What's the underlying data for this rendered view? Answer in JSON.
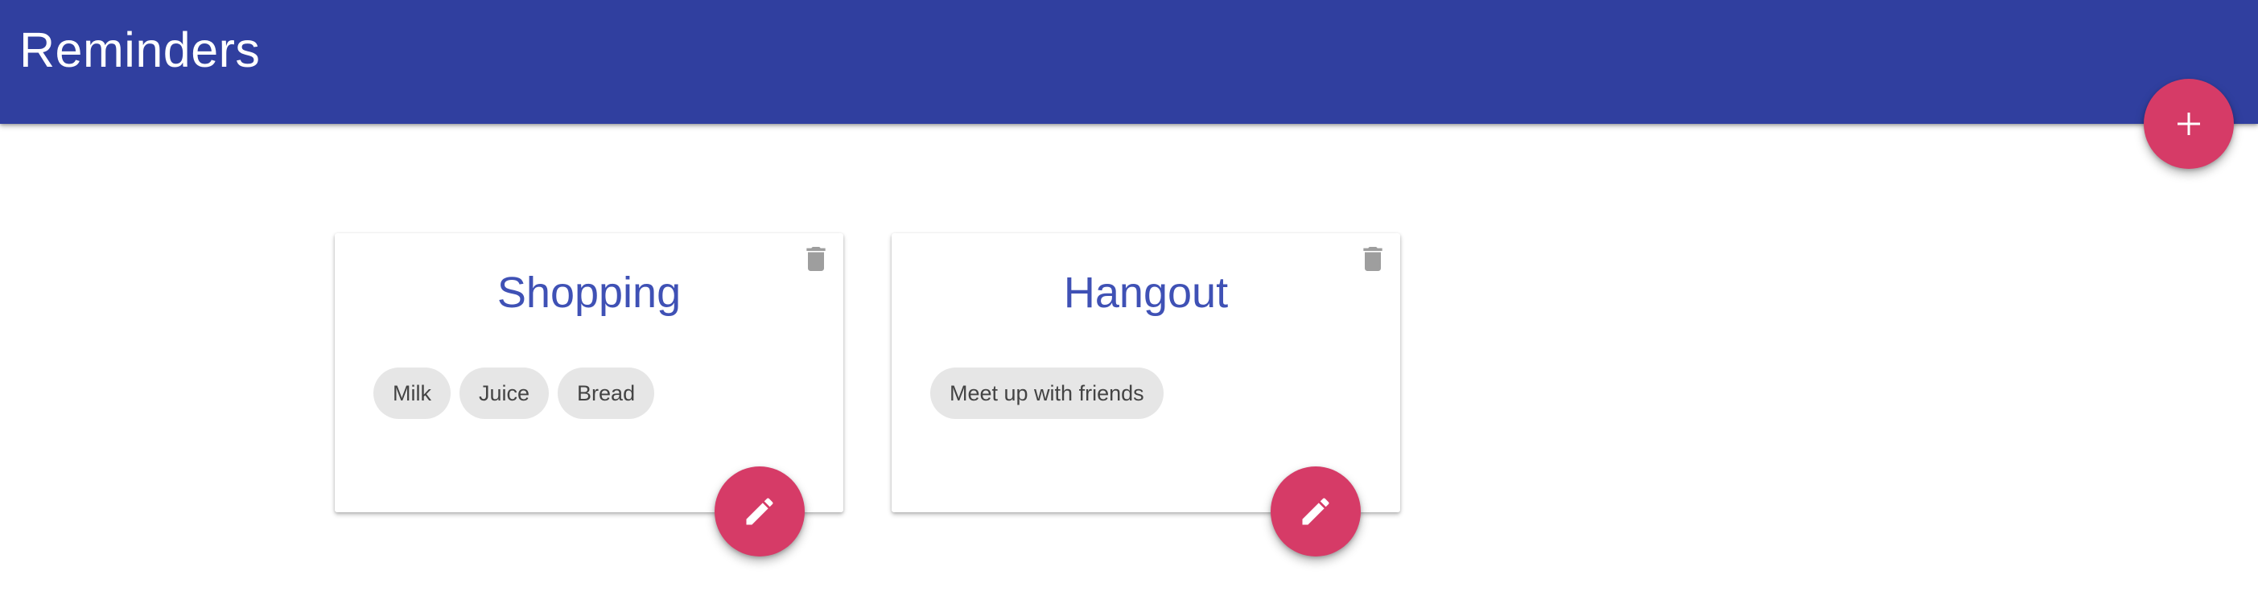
{
  "app": {
    "title": "Reminders",
    "colors": {
      "appbar": "#303f9f",
      "accent": "#d63b67",
      "card_title": "#3f51b5",
      "chip_bg": "#e6e6e6"
    }
  },
  "actions": {
    "add_icon": "plus-icon"
  },
  "cards": [
    {
      "title": "Shopping",
      "delete_icon": "trash-icon",
      "edit_icon": "pencil-icon",
      "items": [
        "Milk",
        "Juice",
        "Bread"
      ]
    },
    {
      "title": "Hangout",
      "delete_icon": "trash-icon",
      "edit_icon": "pencil-icon",
      "items": [
        "Meet up with friends"
      ]
    }
  ]
}
